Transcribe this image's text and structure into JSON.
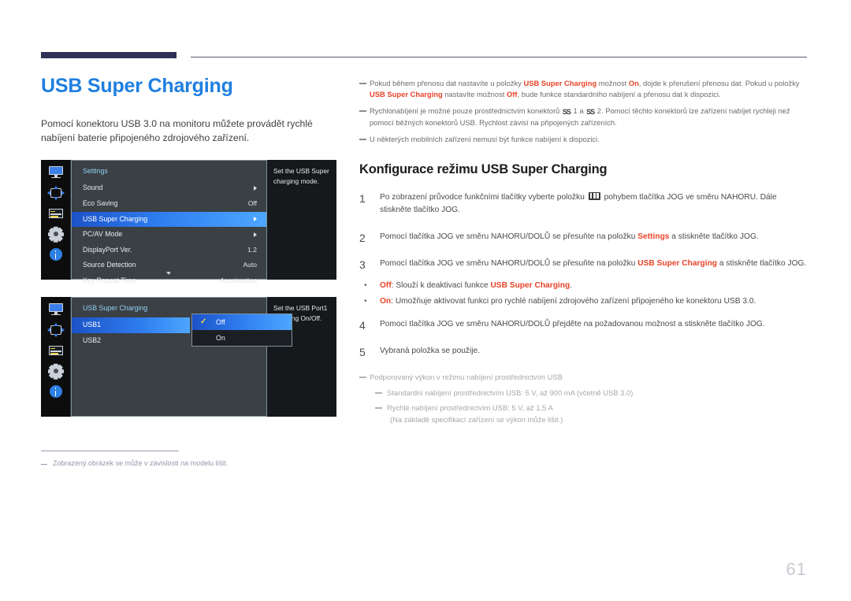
{
  "page": {
    "number": "61",
    "title": "USB Super Charging",
    "intro": "Pomocí konektoru USB 3.0 na monitoru můžete provádět rychlé nabíjení baterie připojeného zdrojového zařízení."
  },
  "osd1": {
    "header": "Settings",
    "description": "Set the USB Super charging mode.",
    "scroll_down_icon": "chevron-down-icon",
    "rail_icons": [
      "monitor-icon",
      "dpad-icon",
      "list-icon",
      "gear-icon",
      "info-icon"
    ],
    "rows": [
      {
        "label": "Sound",
        "value": "",
        "arrow": true,
        "selected": false
      },
      {
        "label": "Eco Saving",
        "value": "Off",
        "arrow": false,
        "selected": false
      },
      {
        "label": "USB Super Charging",
        "value": "",
        "arrow": true,
        "selected": true
      },
      {
        "label": "PC/AV Mode",
        "value": "",
        "arrow": true,
        "selected": false
      },
      {
        "label": "DisplayPort Ver.",
        "value": "1.2",
        "arrow": false,
        "selected": false
      },
      {
        "label": "Source Detection",
        "value": "Auto",
        "arrow": false,
        "selected": false
      },
      {
        "label": "Key Repeat Time",
        "value": "Acceleration",
        "arrow": false,
        "selected": false
      }
    ]
  },
  "osd2": {
    "header": "USB Super Charging",
    "description": "Set the USB Port1 charging On/Off.",
    "rail_icons": [
      "monitor-icon",
      "dpad-icon",
      "list-icon",
      "gear-icon",
      "info-icon"
    ],
    "items": [
      {
        "label": "USB1",
        "selected": true
      },
      {
        "label": "USB2",
        "selected": false
      }
    ],
    "popup": {
      "check_glyph": "✓",
      "options": [
        {
          "label": "Off",
          "checked": true,
          "selected": true
        },
        {
          "label": "On",
          "checked": false,
          "selected": false
        }
      ]
    }
  },
  "left_footnote": "Zobrazený obrázek se může v závislosti na modelu lišit.",
  "notes": [
    {
      "parts": [
        {
          "t": "Pokud během přenosu dat nastavíte u položky ",
          "red": false
        },
        {
          "t": "USB Super Charging",
          "red": true
        },
        {
          "t": " možnost ",
          "red": false
        },
        {
          "t": "On",
          "red": true
        },
        {
          "t": ", dojde k přerušení přenosu dat. Pokud u položky ",
          "red": false
        },
        {
          "t": "USB Super Charging",
          "red": true
        },
        {
          "t": " nastavíte možnost ",
          "red": false
        },
        {
          "t": "Off",
          "red": true
        },
        {
          "t": ", bude funkce standardního nabíjení a přenosu dat k dispozici.",
          "red": false
        }
      ]
    },
    {
      "parts": [
        {
          "t": "Rychlonabíjení je možné pouze prostřednictvím konektorů ",
          "red": false
        },
        {
          "t": "SS",
          "glyph": true
        },
        {
          "t": " 1 a ",
          "red": false
        },
        {
          "t": "SS",
          "glyph": true
        },
        {
          "t": " 2. Pomocí těchto konektorů lze zařízení nabíjet rychleji než pomocí běžných konektorů USB. Rychlost závisí na připojených zařízeních.",
          "red": false
        }
      ]
    },
    {
      "parts": [
        {
          "t": "U některých mobilních zařízení nemusí být funkce nabíjení k dispozici.",
          "red": false
        }
      ]
    }
  ],
  "section": {
    "title": "Konfigurace režimu USB Super Charging"
  },
  "steps": [
    {
      "num": "1",
      "parts": [
        {
          "t": "Po zobrazení průvodce funkčními tlačítky vyberte položku ",
          "red": false
        },
        {
          "t": "menu",
          "menuglyph": true
        },
        {
          "t": " pohybem tlačítka JOG ve směru NAHORU. Dále stiskněte tlačítko JOG.",
          "red": false
        }
      ]
    },
    {
      "num": "2",
      "parts": [
        {
          "t": "Pomocí tlačítka JOG ve směru NAHORU/DOLŮ se přesuňte na položku ",
          "red": false
        },
        {
          "t": "Settings",
          "red": true
        },
        {
          "t": " a stiskněte tlačítko JOG.",
          "red": false
        }
      ]
    },
    {
      "num": "3",
      "parts": [
        {
          "t": "Pomocí tlačítka JOG ve směru NAHORU/DOLŮ se přesuňte na položku ",
          "red": false
        },
        {
          "t": "USB Super Charging",
          "red": true
        },
        {
          "t": " a stiskněte tlačítko JOG.",
          "red": false
        }
      ]
    }
  ],
  "bullets": [
    {
      "marker": "•",
      "parts": [
        {
          "t": "Off",
          "red": true
        },
        {
          "t": ": Slouží k deaktivaci funkce ",
          "red": false
        },
        {
          "t": "USB Super Charging",
          "red": true
        },
        {
          "t": ".",
          "red": false
        }
      ]
    },
    {
      "marker": "•",
      "parts": [
        {
          "t": "On",
          "red": true
        },
        {
          "t": ": Umožňuje aktivovat funkci pro rychlé nabíjení zdrojového zařízení připojeného ke konektoru USB 3.0.",
          "red": false
        }
      ]
    }
  ],
  "steps_after": [
    {
      "num": "4",
      "parts": [
        {
          "t": "Pomocí tlačítka JOG ve směru NAHORU/DOLŮ přejděte na požadovanou možnost a stiskněte tlačítko JOG.",
          "red": false
        }
      ]
    },
    {
      "num": "5",
      "parts": [
        {
          "t": "Vybraná položka se použije.",
          "red": false
        }
      ]
    }
  ],
  "tail": {
    "heading": "Podporovaný výkon v režimu nabíjení prostřednictvím USB",
    "subs": [
      {
        "text": "Standardní nabíjení prostřednictvím USB: 5 V, až 900 mA (včetně USB 3.0)",
        "cont": ""
      },
      {
        "text": "Rychlé nabíjení prostřednictvím USB: 5 V, až 1,5 A",
        "cont": "(Na základě specifikací zařízení se výkon může lišit.)"
      }
    ]
  },
  "colors": {
    "title_blue": "#1f7fe0",
    "rule_navy": "#2e3257",
    "accent_red": "#e8432a",
    "osd_highlight_blue": "#2f7ef0",
    "check_yellow": "#f2d94e"
  }
}
